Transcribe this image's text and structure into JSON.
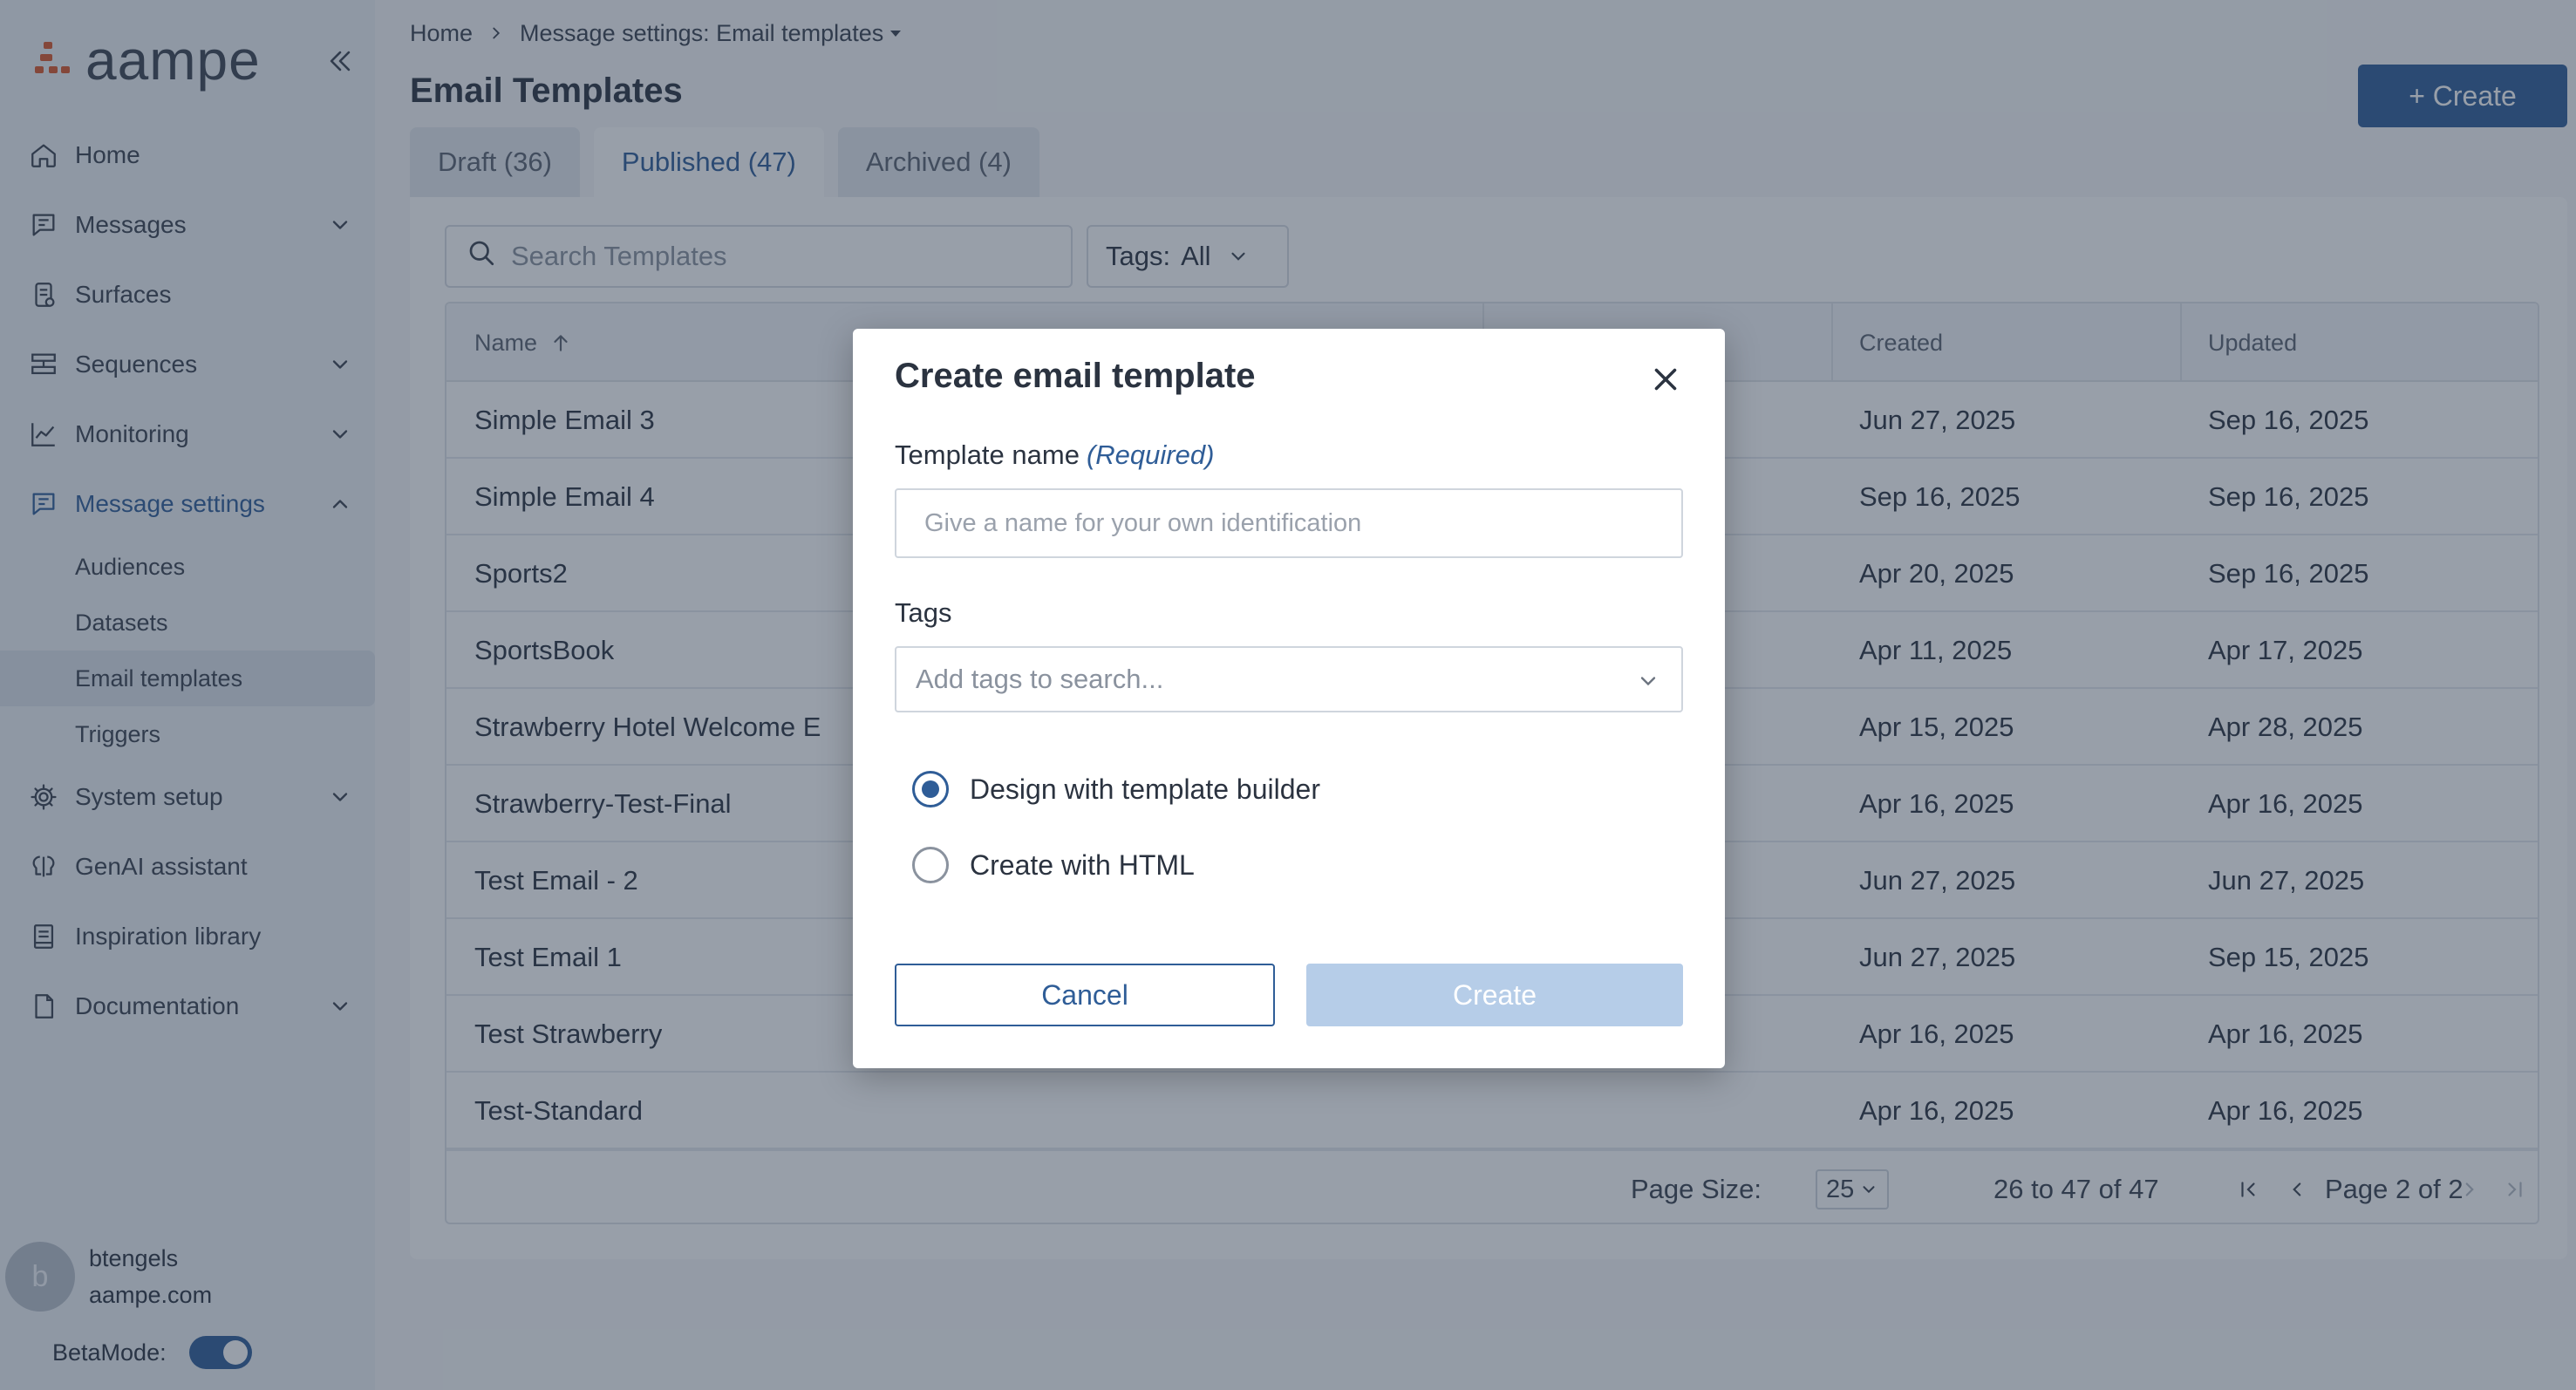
{
  "brand": {
    "name": "aampe"
  },
  "sidebar": {
    "items": [
      {
        "label": "Home",
        "icon": "home-icon"
      },
      {
        "label": "Messages",
        "icon": "message-icon"
      },
      {
        "label": "Surfaces",
        "icon": "surfaces-icon"
      },
      {
        "label": "Sequences",
        "icon": "sequences-icon"
      },
      {
        "label": "Monitoring",
        "icon": "chart-line-icon"
      },
      {
        "label": "Message settings",
        "icon": "message-settings-icon"
      },
      {
        "label": "System setup",
        "icon": "gear-icon"
      },
      {
        "label": "GenAI assistant",
        "icon": "genai-icon"
      },
      {
        "label": "Inspiration library",
        "icon": "library-icon"
      },
      {
        "label": "Documentation",
        "icon": "document-icon"
      }
    ],
    "sub_items": [
      "Audiences",
      "Datasets",
      "Email templates",
      "Triggers"
    ],
    "user": {
      "initial": "b",
      "name": "btengels",
      "domain": "aampe.com"
    },
    "beta_label": "BetaMode:",
    "beta_enabled": true
  },
  "breadcrumb": {
    "home": "Home",
    "current": "Message settings: Email templates"
  },
  "page": {
    "title": "Email Templates",
    "create_label": "+ Create"
  },
  "tabs": [
    {
      "label": "Draft (36)"
    },
    {
      "label": "Published (47)"
    },
    {
      "label": "Archived (4)"
    }
  ],
  "filters": {
    "search_placeholder": "Search Templates",
    "tags_label": "Tags:",
    "tags_value": "All"
  },
  "table": {
    "columns": {
      "name": "Name",
      "created": "Created",
      "updated": "Updated"
    },
    "rows": [
      {
        "name": "Simple Email 3",
        "created": "Jun 27, 2025",
        "updated": "Sep 16, 2025"
      },
      {
        "name": "Simple Email 4",
        "created": "Sep 16, 2025",
        "updated": "Sep 16, 2025"
      },
      {
        "name": "Sports2",
        "created": "Apr 20, 2025",
        "updated": "Sep 16, 2025"
      },
      {
        "name": "SportsBook",
        "created": "Apr 11, 2025",
        "updated": "Apr 17, 2025"
      },
      {
        "name": "Strawberry Hotel Welcome E",
        "created": "Apr 15, 2025",
        "updated": "Apr 28, 2025"
      },
      {
        "name": "Strawberry-Test-Final",
        "created": "Apr 16, 2025",
        "updated": "Apr 16, 2025"
      },
      {
        "name": "Test Email - 2",
        "created": "Jun 27, 2025",
        "updated": "Jun 27, 2025"
      },
      {
        "name": "Test Email 1",
        "created": "Jun 27, 2025",
        "updated": "Sep 15, 2025"
      },
      {
        "name": "Test Strawberry",
        "created": "Apr 16, 2025",
        "updated": "Apr 16, 2025"
      },
      {
        "name": "Test-Standard",
        "created": "Apr 16, 2025",
        "updated": "Apr 16, 2025"
      }
    ]
  },
  "pagination": {
    "page_size_label": "Page Size:",
    "page_size": "25",
    "range": "26 to 47 of 47",
    "page_label": "Page 2 of 2"
  },
  "modal": {
    "title": "Create email template",
    "name_label": "Template name",
    "required_label": "(Required)",
    "name_placeholder": "Give a name for your own identification",
    "tags_label": "Tags",
    "tags_placeholder": "Add tags to search...",
    "options": [
      "Design with template builder",
      "Create with HTML"
    ],
    "selected_option": 0,
    "cancel_label": "Cancel",
    "create_label": "Create"
  },
  "colors": {
    "accent": "#2f5d97",
    "brand_mark": "#d9562b",
    "disabled_button": "#b6cde8"
  }
}
